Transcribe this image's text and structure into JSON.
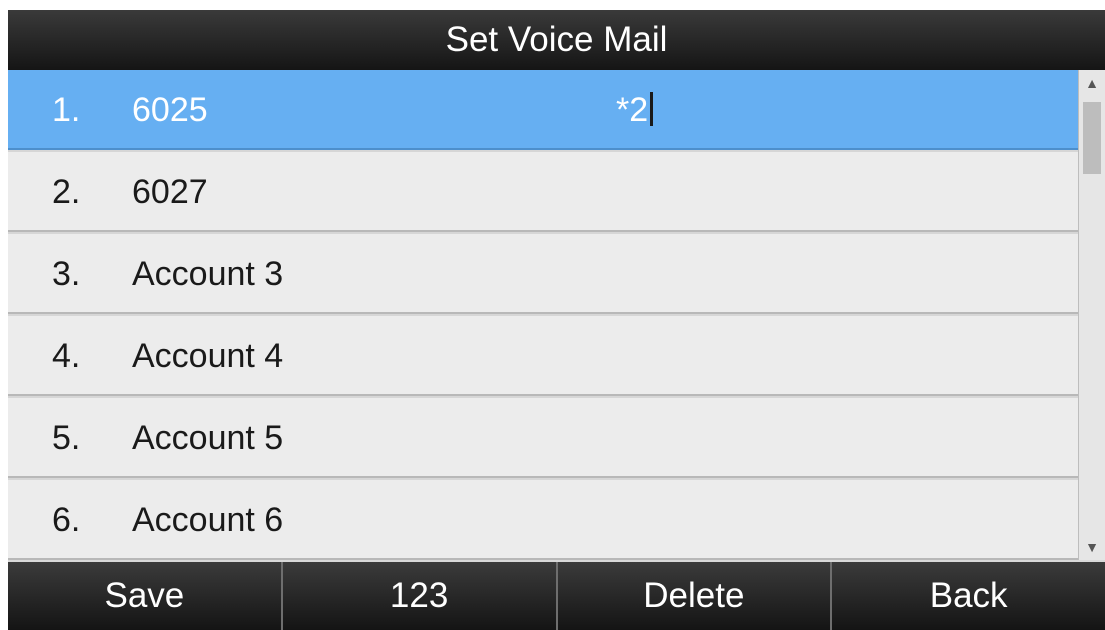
{
  "title": "Set Voice Mail",
  "accounts": [
    {
      "number": "1.",
      "name": "6025",
      "code": "*2"
    },
    {
      "number": "2.",
      "name": "6027",
      "code": ""
    },
    {
      "number": "3.",
      "name": "Account 3",
      "code": ""
    },
    {
      "number": "4.",
      "name": "Account 4",
      "code": ""
    },
    {
      "number": "5.",
      "name": "Account 5",
      "code": ""
    },
    {
      "number": "6.",
      "name": "Account 6",
      "code": ""
    }
  ],
  "selected_index": 0,
  "scroll_icons": {
    "up": "triangle-up-icon",
    "down": "triangle-down-icon"
  },
  "softkeys": {
    "save": "Save",
    "input_mode": "123",
    "delete": "Delete",
    "back": "Back"
  },
  "colors": {
    "selected_row": "#66aff2",
    "row": "#ececec",
    "title_bar": "#1f1f1f",
    "softkey_bar": "#1f1f1f"
  }
}
